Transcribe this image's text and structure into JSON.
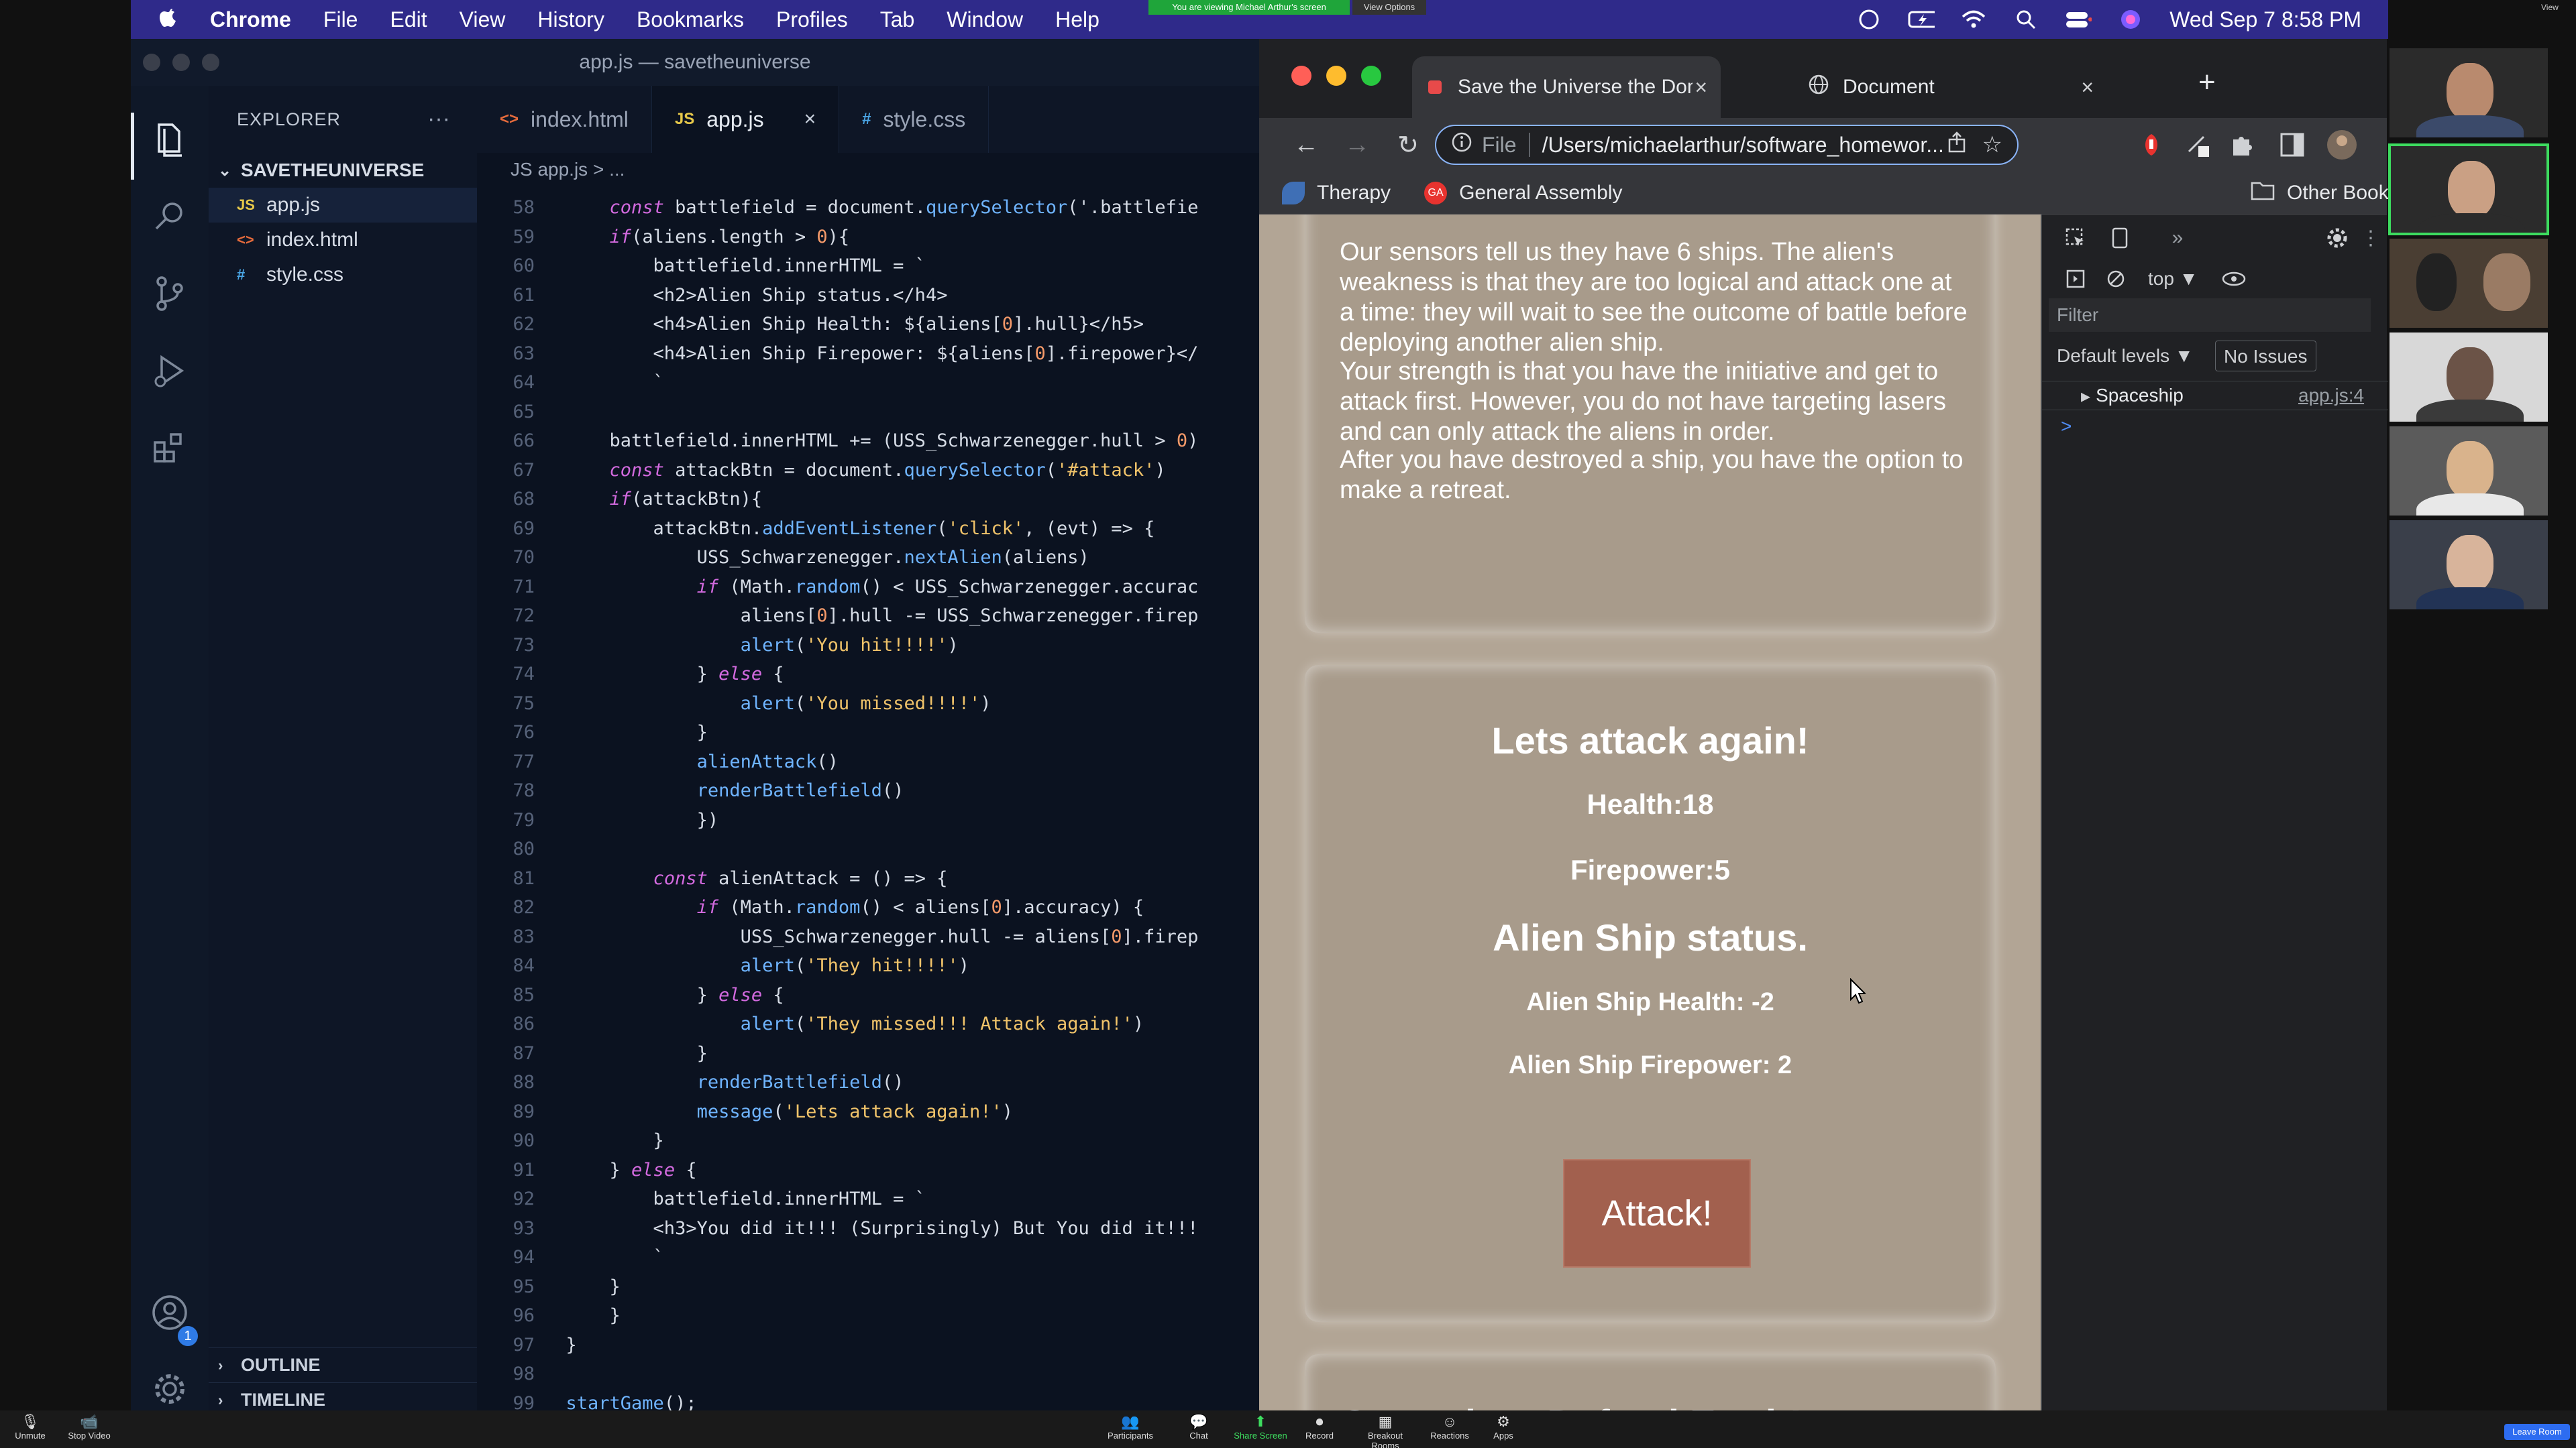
{
  "menubar": {
    "app": "Chrome",
    "items": [
      "File",
      "Edit",
      "View",
      "History",
      "Bookmarks",
      "Profiles",
      "Tab",
      "Window",
      "Help"
    ],
    "clock": "Wed Sep 7  8:58 PM",
    "zoom_banner": "You are viewing Michael Arthur's screen",
    "zoom_view_options": "View Options"
  },
  "vscode": {
    "window_title": "app.js — savetheuniverse",
    "explorer_label": "EXPLORER",
    "explorer_more": "···",
    "folder": "SAVETHEUNIVERSE",
    "files": [
      {
        "icon": "JS",
        "name": "app.js"
      },
      {
        "icon": "<>",
        "name": "index.html"
      },
      {
        "icon": "#",
        "name": "style.css"
      }
    ],
    "outline": "OUTLINE",
    "timeline": "TIMELINE",
    "accounts_badge": "1",
    "tabs": [
      {
        "icon": "<>",
        "label": "index.html"
      },
      {
        "icon": "JS",
        "label": "app.js",
        "close": "×"
      },
      {
        "icon": "#",
        "label": "style.css"
      }
    ],
    "breadcrumb": "JS  app.js > ...",
    "lines": [
      {
        "n": "58",
        "t": "    const battlefield = document.querySelector('.battlefie"
      },
      {
        "n": "59",
        "t": "    if(aliens.length > 0){"
      },
      {
        "n": "60",
        "t": "        battlefield.innerHTML = `"
      },
      {
        "n": "61",
        "t": "        <h2>Alien Ship status.</h4>"
      },
      {
        "n": "62",
        "t": "        <h4>Alien Ship Health: ${aliens[0].hull}</h5>"
      },
      {
        "n": "63",
        "t": "        <h4>Alien Ship Firepower: ${aliens[0].firepower}</"
      },
      {
        "n": "64",
        "t": "        `"
      },
      {
        "n": "65",
        "t": ""
      },
      {
        "n": "66",
        "t": "    battlefield.innerHTML += (USS_Schwarzenegger.hull > 0)"
      },
      {
        "n": "67",
        "t": "    const attackBtn = document.querySelector('#attack')"
      },
      {
        "n": "68",
        "t": "    if(attackBtn){"
      },
      {
        "n": "69",
        "t": "        attackBtn.addEventListener('click', (evt) => {"
      },
      {
        "n": "70",
        "t": "            USS_Schwarzenegger.nextAlien(aliens)"
      },
      {
        "n": "71",
        "t": "            if (Math.random() < USS_Schwarzenegger.accurac"
      },
      {
        "n": "72",
        "t": "                aliens[0].hull -= USS_Schwarzenegger.firep"
      },
      {
        "n": "73",
        "t": "                alert('You hit!!!!')"
      },
      {
        "n": "74",
        "t": "            } else {"
      },
      {
        "n": "75",
        "t": "                alert('You missed!!!!')"
      },
      {
        "n": "76",
        "t": "            }"
      },
      {
        "n": "77",
        "t": "            alienAttack()"
      },
      {
        "n": "78",
        "t": "            renderBattlefield()"
      },
      {
        "n": "79",
        "t": "            })"
      },
      {
        "n": "80",
        "t": ""
      },
      {
        "n": "81",
        "t": "        const alienAttack = () => {"
      },
      {
        "n": "82",
        "t": "            if (Math.random() < aliens[0].accuracy) {"
      },
      {
        "n": "83",
        "t": "                USS_Schwarzenegger.hull -= aliens[0].firep"
      },
      {
        "n": "84",
        "t": "                alert('They hit!!!!')"
      },
      {
        "n": "85",
        "t": "            } else {"
      },
      {
        "n": "86",
        "t": "                alert('They missed!!! Attack again!')"
      },
      {
        "n": "87",
        "t": "            }"
      },
      {
        "n": "88",
        "t": "            renderBattlefield()"
      },
      {
        "n": "89",
        "t": "            message('Lets attack again!')"
      },
      {
        "n": "90",
        "t": "        }"
      },
      {
        "n": "91",
        "t": "    } else {"
      },
      {
        "n": "92",
        "t": "        battlefield.innerHTML = `"
      },
      {
        "n": "93",
        "t": "        <h3>You did it!!! (Surprisingly) But You did it!!!"
      },
      {
        "n": "94",
        "t": "        `"
      },
      {
        "n": "95",
        "t": "    }"
      },
      {
        "n": "96",
        "t": "    }"
      },
      {
        "n": "97",
        "t": "}"
      },
      {
        "n": "98",
        "t": ""
      },
      {
        "n": "99",
        "t": "startGame();"
      }
    ]
  },
  "chrome": {
    "tabs": [
      {
        "label": "Save the Universe the Dom | W",
        "close": "×"
      },
      {
        "label": "Document",
        "close": "×"
      }
    ],
    "new_tab": "+",
    "url_scheme": "File",
    "url": "/Users/michaelarthur/software_homewor...",
    "bookmarks": [
      "Therapy",
      "General Assembly"
    ],
    "other_bookmarks": "Other Bookm"
  },
  "page": {
    "intro_p1": "Our sensors tell us they have 6 ships. The alien's weakness is that they are too logical and attack one at a time: they will wait to see the outcome of battle before deploying another alien ship.",
    "intro_p2": "Your strength is that you have the initiative and get to attack first. However, you do not have targeting lasers and can only attack the aliens in order.",
    "intro_p3": "After you have destroyed a ship, you have the option to make a retreat.",
    "message": "Lets attack again!",
    "health": "Health:18",
    "firepower": "Firepower:5",
    "alien_status": "Alien Ship status.",
    "alien_health": "Alien Ship Health: -2",
    "alien_firepower": "Alien Ship Firepower: 2",
    "attack_button": "Attack!",
    "next_heading": "Operation: Defend Earth!"
  },
  "devtools": {
    "more": "»",
    "context": "top ▼",
    "filter_placeholder": "Filter",
    "levels": "Default levels ▼",
    "issues": "No Issues",
    "log_entry": "Spaceship",
    "log_source": "app.js:4",
    "prompt": ">"
  },
  "zoom": {
    "unmute": "Unmute",
    "stop_video": "Stop Video",
    "participants": "Participants",
    "chat": "Chat",
    "share": "Share Screen",
    "record": "Record",
    "breakout": "Breakout Rooms",
    "reactions": "Reactions",
    "apps": "Apps",
    "leave": "Leave Room",
    "view": "View"
  }
}
